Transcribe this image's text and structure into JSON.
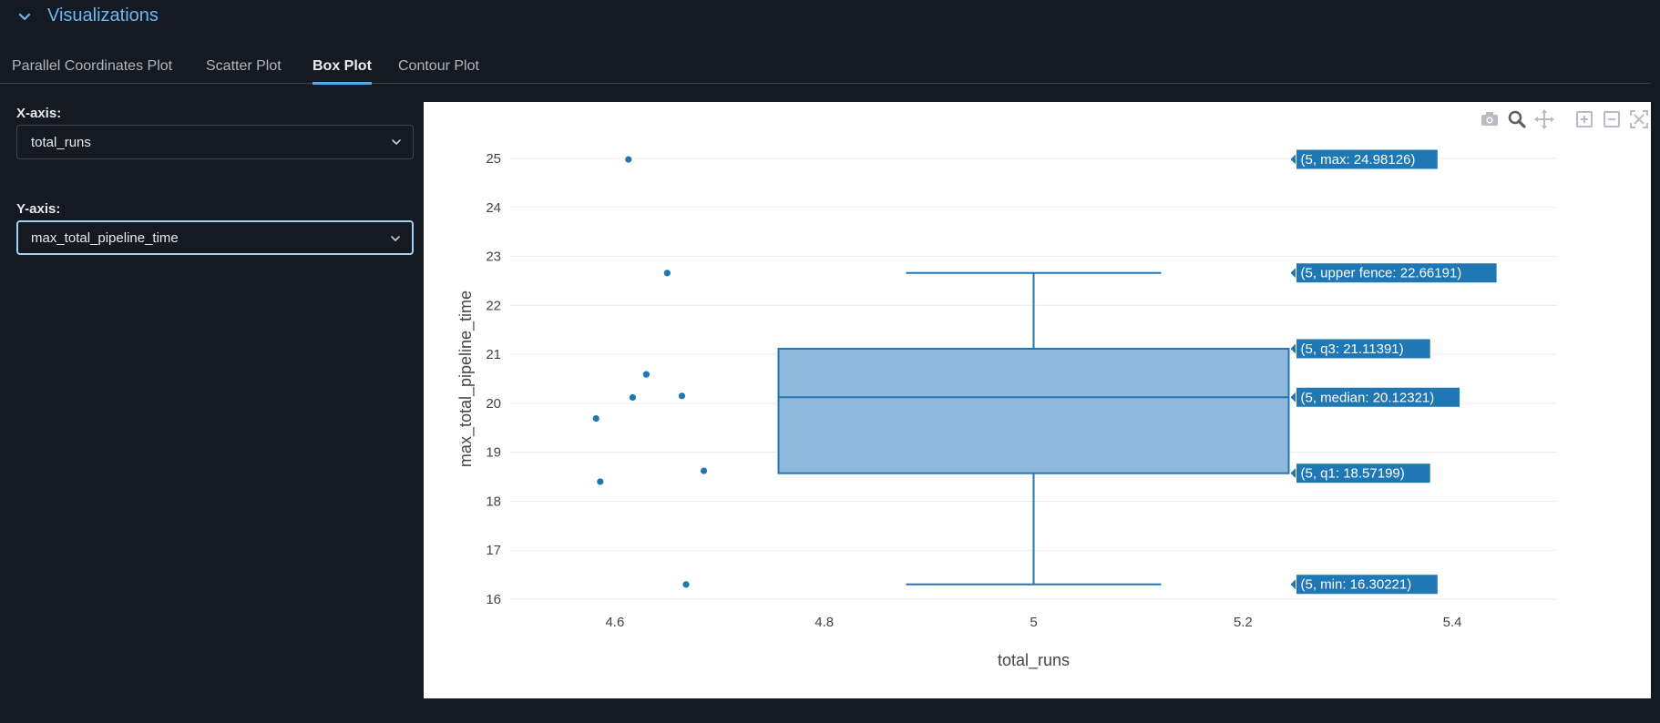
{
  "section": {
    "title": "Visualizations",
    "expanded": true
  },
  "tabs": [
    {
      "label": "Parallel Coordinates Plot",
      "active": false
    },
    {
      "label": "Scatter Plot",
      "active": false
    },
    {
      "label": "Box Plot",
      "active": true
    },
    {
      "label": "Contour Plot",
      "active": false
    }
  ],
  "controls": {
    "x_label": "X-axis:",
    "x_value": "total_runs",
    "y_label": "Y-axis:",
    "y_value": "max_total_pipeline_time"
  },
  "modebar": [
    "camera-icon",
    "zoom-icon",
    "pan-icon",
    "zoom-in-icon",
    "zoom-out-icon",
    "autoscale-icon"
  ],
  "colors": {
    "accent": "#5aa9e6",
    "box_fill": "#8fb9dc",
    "box_line": "#1f77b4",
    "point": "#1f77b4",
    "label_bg": "#1f77b4",
    "background": "#141a22"
  },
  "chart_data": {
    "type": "box",
    "xlabel": "total_runs",
    "ylabel": "max_total_pipeline_time",
    "xlim": [
      4.5,
      5.5
    ],
    "ylim": [
      16,
      25
    ],
    "x_ticks": [
      "4.6",
      "4.8",
      "5",
      "5.2",
      "5.4"
    ],
    "x_tick_values": [
      4.6,
      4.8,
      5.0,
      5.2,
      5.4
    ],
    "y_ticks": [
      "16",
      "17",
      "18",
      "19",
      "20",
      "21",
      "22",
      "23",
      "24",
      "25"
    ],
    "y_tick_values": [
      16,
      17,
      18,
      19,
      20,
      21,
      22,
      23,
      24,
      25
    ],
    "grid": true,
    "box": {
      "x": 5,
      "min": 16.30221,
      "q1": 18.57199,
      "median": 20.12321,
      "q3": 21.11391,
      "upper_fence": 22.66191,
      "max": 24.98126
    },
    "hover_labels": [
      {
        "text": "(5, max: 24.98126)",
        "y": 24.98126
      },
      {
        "text": "(5, upper fence: 22.66191)",
        "y": 22.66191
      },
      {
        "text": "(5, q3: 21.11391)",
        "y": 21.11391
      },
      {
        "text": "(5, median: 20.12321)",
        "y": 20.12321
      },
      {
        "text": "(5, q1: 18.57199)",
        "y": 18.57199
      },
      {
        "text": "(5, min: 16.30221)",
        "y": 16.30221
      }
    ],
    "points": [
      {
        "x": 4.613,
        "y": 24.98
      },
      {
        "x": 4.65,
        "y": 22.66
      },
      {
        "x": 4.63,
        "y": 20.59
      },
      {
        "x": 4.617,
        "y": 20.12
      },
      {
        "x": 4.664,
        "y": 20.15
      },
      {
        "x": 4.582,
        "y": 19.69
      },
      {
        "x": 4.685,
        "y": 18.62
      },
      {
        "x": 4.586,
        "y": 18.4
      },
      {
        "x": 4.668,
        "y": 16.3
      }
    ]
  }
}
